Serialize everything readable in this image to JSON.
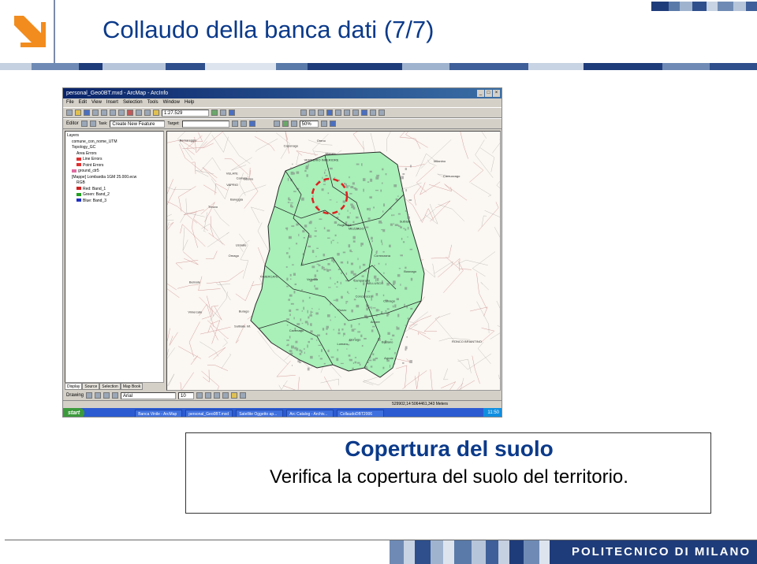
{
  "slide": {
    "title": "Collaudo della banca dati (7/7)",
    "brand": "POLITECNICO DI MILANO",
    "colors": {
      "title": "#0b3a8a",
      "accent_orange": "#f28c1e",
      "footer_blue": "#1f3c7a"
    }
  },
  "screenshot": {
    "window_title": "personal_Geo0BT.mxd - ArcMap - ArcInfo",
    "menu": [
      "File",
      "Edit",
      "View",
      "Insert",
      "Selection",
      "Tools",
      "Window",
      "Help"
    ],
    "scale": "1:27.529",
    "editor_label": "Editor",
    "task_value": "Create New Feature",
    "target_label": "Target:",
    "zoom_value": "50%",
    "toc_items": [
      {
        "text": "Layers",
        "swatch": ""
      },
      {
        "text": "comune_con_nome_UTM",
        "swatch": ""
      },
      {
        "text": "Topology_GC",
        "swatch": ""
      },
      {
        "text": "Area Errors",
        "swatch": ""
      },
      {
        "text": "Line Errors",
        "swatch": "#e03030"
      },
      {
        "text": "Point Errors",
        "swatch": "#e03030"
      },
      {
        "text": "ground_ctr5",
        "swatch": "#e06aa0"
      },
      {
        "text": "[Mappe] Lombardia 1GM 25.000.ecw",
        "swatch": ""
      },
      {
        "text": "RGB",
        "swatch": ""
      },
      {
        "text": "Red: Band_1",
        "swatch": "#d02020"
      },
      {
        "text": "Green: Band_2",
        "swatch": "#20a020"
      },
      {
        "text": "Blue: Band_3",
        "swatch": "#2030c0"
      }
    ],
    "toc_tabs": [
      "Display",
      "Source",
      "Selection",
      "Map Book"
    ],
    "drawing_label": "Drawing",
    "font_value": "Arial",
    "font_size": "10",
    "coordinates": "529902,14  5064461,343 Meters",
    "taskbar": {
      "start": "start",
      "items": [
        "Banca Vinile - ArcMap",
        "personal_Geo0BT.mxd",
        "Satellite Oggetto ap...",
        "Arc Catalog - Archiv...",
        "CollaudoDBT2006"
      ],
      "clock": "11:50"
    },
    "map_labels": [
      "Donago",
      "Lomaro",
      "Usmate",
      "VELATE",
      "Bernareggio",
      "Vimercate",
      "Sulbiate",
      "RONCO BRIANTINO",
      "VERDERIO INFERIORE",
      "Arcore",
      "Concorezzo",
      "Agrate",
      "Burago",
      "Cavenago",
      "Ornago",
      "Busnago",
      "Camparada",
      "Carnate",
      "BELLUSCO",
      "MEZZAGO",
      "Trezzo",
      "VAPRIO",
      "Correzzana",
      "Lesmo",
      "Colnago",
      "Bareggia",
      "Camuzzago",
      "Ruginello",
      "Oreno",
      "Velasca",
      "Bernate",
      "Milanino",
      "Sulbiate Inf.",
      "Pozzo",
      "Basiano",
      "Masate",
      "Caponago",
      "VIMERCATE"
    ]
  },
  "caption": {
    "heading": "Copertura del suolo",
    "text": "Verifica la copertura del suolo del territorio."
  }
}
